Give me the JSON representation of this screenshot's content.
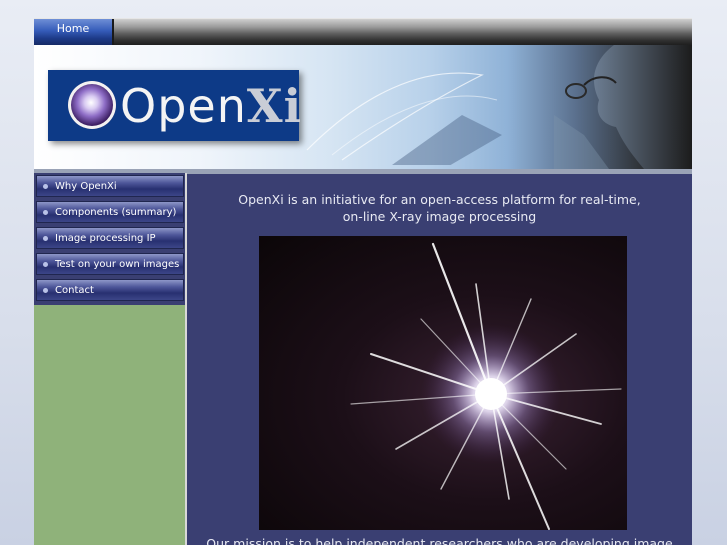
{
  "topnav": {
    "home_label": "Home"
  },
  "banner": {
    "logo_text_open": "Open",
    "logo_text_xi": "Xi"
  },
  "sidebar": {
    "items": [
      {
        "label": "Why OpenXi"
      },
      {
        "label": "Components (summary)"
      },
      {
        "label": "Image processing IP"
      },
      {
        "label": "Test on your own images"
      },
      {
        "label": "Contact"
      }
    ]
  },
  "main": {
    "intro_line1": "OpenXi is an initiative for an open-access platform for real-time,",
    "intro_line2": "on-line X-ray image processing",
    "mission_partial": "Our mission is to help independent researchers who are developing image"
  },
  "colors": {
    "page_bg": "#3a3f72",
    "sidebar_green": "#8fb27a",
    "logo_blue": "#0d3a87"
  }
}
